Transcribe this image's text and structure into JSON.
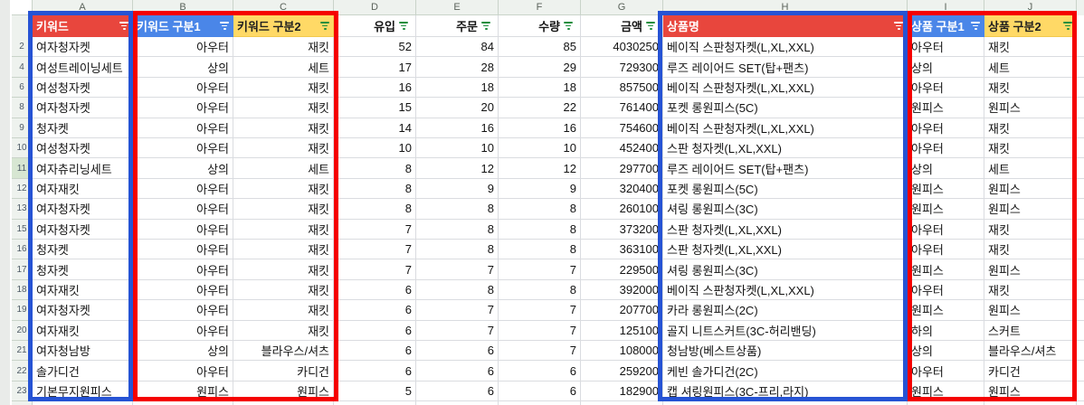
{
  "sheet": {
    "column_letters": [
      "A",
      "B",
      "C",
      "D",
      "E",
      "F",
      "G",
      "H",
      "I",
      "J"
    ],
    "columns": [
      {
        "letter": "A",
        "header": "키워드",
        "fill": "red",
        "icon_color": "white"
      },
      {
        "letter": "B",
        "header": "키워드 구분1",
        "fill": "blue",
        "icon_color": "white"
      },
      {
        "letter": "C",
        "header": "키워드 구분2",
        "fill": "yellow",
        "icon_color": "green"
      },
      {
        "letter": "D",
        "header": "유입",
        "fill": "white",
        "icon_color": "green"
      },
      {
        "letter": "E",
        "header": "주문",
        "fill": "white",
        "icon_color": "green"
      },
      {
        "letter": "F",
        "header": "수량",
        "fill": "white",
        "icon_color": "green"
      },
      {
        "letter": "G",
        "header": "금액",
        "fill": "white",
        "icon_color": "green"
      },
      {
        "letter": "H",
        "header": "상품명",
        "fill": "red",
        "icon_color": "white"
      },
      {
        "letter": "I",
        "header": "상품 구분1",
        "fill": "blue",
        "icon_color": "white"
      },
      {
        "letter": "J",
        "header": "상품 구분2",
        "fill": "yellow",
        "icon_color": "green"
      }
    ],
    "rows": [
      {
        "n": "2",
        "a": "여자청자켓",
        "b": "아우터",
        "c": "재킷",
        "d": "52",
        "e": "84",
        "f": "85",
        "g": "4030250",
        "h": "베이직 스판청자켓(L,XL,XXL)",
        "i": "아우터",
        "j": "재킷"
      },
      {
        "n": "4",
        "a": "여성트레이닝세트",
        "b": "상의",
        "c": "세트",
        "d": "17",
        "e": "28",
        "f": "29",
        "g": "729300",
        "h": "루즈 레이어드 SET(탑+팬츠)",
        "i": "상의",
        "j": "세트"
      },
      {
        "n": "6",
        "a": "여성청자켓",
        "b": "아우터",
        "c": "재킷",
        "d": "16",
        "e": "18",
        "f": "18",
        "g": "857500",
        "h": "베이직 스판청자켓(L,XL,XXL)",
        "i": "아우터",
        "j": "재킷"
      },
      {
        "n": "8",
        "a": "여자청자켓",
        "b": "아우터",
        "c": "재킷",
        "d": "15",
        "e": "20",
        "f": "22",
        "g": "761400",
        "h": "포켓 롱원피스(5C)",
        "i": "원피스",
        "j": "원피스"
      },
      {
        "n": "9",
        "a": "청자켓",
        "b": "아우터",
        "c": "재킷",
        "d": "14",
        "e": "16",
        "f": "16",
        "g": "754600",
        "h": "베이직 스판청자켓(L,XL,XXL)",
        "i": "아우터",
        "j": "재킷"
      },
      {
        "n": "10",
        "a": "여성청자켓",
        "b": "아우터",
        "c": "재킷",
        "d": "10",
        "e": "10",
        "f": "10",
        "g": "452400",
        "h": "스판 청자켓(L,XL,XXL)",
        "i": "아우터",
        "j": "재킷"
      },
      {
        "n": "11",
        "a": "여자츄리닝세트",
        "b": "상의",
        "c": "세트",
        "d": "8",
        "e": "12",
        "f": "12",
        "g": "297700",
        "h": "루즈 레이어드 SET(탑+팬츠)",
        "i": "상의",
        "j": "세트"
      },
      {
        "n": "12",
        "a": "여자재킷",
        "b": "아우터",
        "c": "재킷",
        "d": "8",
        "e": "9",
        "f": "9",
        "g": "320400",
        "h": "포켓 롱원피스(5C)",
        "i": "원피스",
        "j": "원피스"
      },
      {
        "n": "13",
        "a": "여자청자켓",
        "b": "아우터",
        "c": "재킷",
        "d": "8",
        "e": "8",
        "f": "8",
        "g": "260100",
        "h": "셔링 롱원피스(3C)",
        "i": "원피스",
        "j": "원피스"
      },
      {
        "n": "15",
        "a": "여자청자켓",
        "b": "아우터",
        "c": "재킷",
        "d": "7",
        "e": "8",
        "f": "8",
        "g": "373200",
        "h": "스판 청자켓(L,XL,XXL)",
        "i": "아우터",
        "j": "재킷"
      },
      {
        "n": "16",
        "a": "청자켓",
        "b": "아우터",
        "c": "재킷",
        "d": "7",
        "e": "8",
        "f": "8",
        "g": "363100",
        "h": "스판 청자켓(L,XL,XXL)",
        "i": "아우터",
        "j": "재킷"
      },
      {
        "n": "17",
        "a": "청자켓",
        "b": "아우터",
        "c": "재킷",
        "d": "7",
        "e": "7",
        "f": "7",
        "g": "229500",
        "h": "셔링 롱원피스(3C)",
        "i": "원피스",
        "j": "원피스"
      },
      {
        "n": "18",
        "a": "여자재킷",
        "b": "아우터",
        "c": "재킷",
        "d": "6",
        "e": "8",
        "f": "8",
        "g": "392000",
        "h": "베이직 스판청자켓(L,XL,XXL)",
        "i": "아우터",
        "j": "재킷"
      },
      {
        "n": "19",
        "a": "여자청자켓",
        "b": "아우터",
        "c": "재킷",
        "d": "6",
        "e": "7",
        "f": "7",
        "g": "207700",
        "h": "카라 롱원피스(2C)",
        "i": "원피스",
        "j": "원피스"
      },
      {
        "n": "20",
        "a": "여자재킷",
        "b": "아우터",
        "c": "재킷",
        "d": "6",
        "e": "7",
        "f": "7",
        "g": "125100",
        "h": "골지 니트스커트(3C-허리밴딩)",
        "i": "하의",
        "j": "스커트"
      },
      {
        "n": "21",
        "a": "여자청남방",
        "b": "상의",
        "c": "블라우스/셔츠",
        "d": "6",
        "e": "6",
        "f": "7",
        "g": "108000",
        "h": "청남방(베스트상품)",
        "i": "상의",
        "j": "블라우스/셔츠"
      },
      {
        "n": "22",
        "a": "솔가디건",
        "b": "아우터",
        "c": "카디건",
        "d": "6",
        "e": "6",
        "f": "6",
        "g": "259200",
        "h": "케빈 솔가디건(2C)",
        "i": "아우터",
        "j": "카디건"
      },
      {
        "n": "23",
        "a": "기본무지원피스",
        "b": "원피스",
        "c": "원피스",
        "d": "5",
        "e": "6",
        "f": "6",
        "g": "182900",
        "h": "캡 셔링원피스(3C-프리,라지)",
        "i": "원피스",
        "j": "원피스"
      }
    ],
    "highlighted_row_number": "11",
    "hidden_rows": [
      "3",
      "5",
      "7",
      "14"
    ],
    "annotation_boxes": [
      {
        "around": "column A",
        "color": "blue"
      },
      {
        "around": "columns B-C",
        "color": "red"
      },
      {
        "around": "column H",
        "color": "blue"
      },
      {
        "around": "columns I-J",
        "color": "red"
      }
    ],
    "colors": {
      "header_red": "#e8463d",
      "header_blue": "#4a86e8",
      "header_yellow": "#ffd966",
      "box_blue": "#2653d4",
      "box_red": "#f50000",
      "filter_icon_green": "#1e8e3e"
    }
  }
}
